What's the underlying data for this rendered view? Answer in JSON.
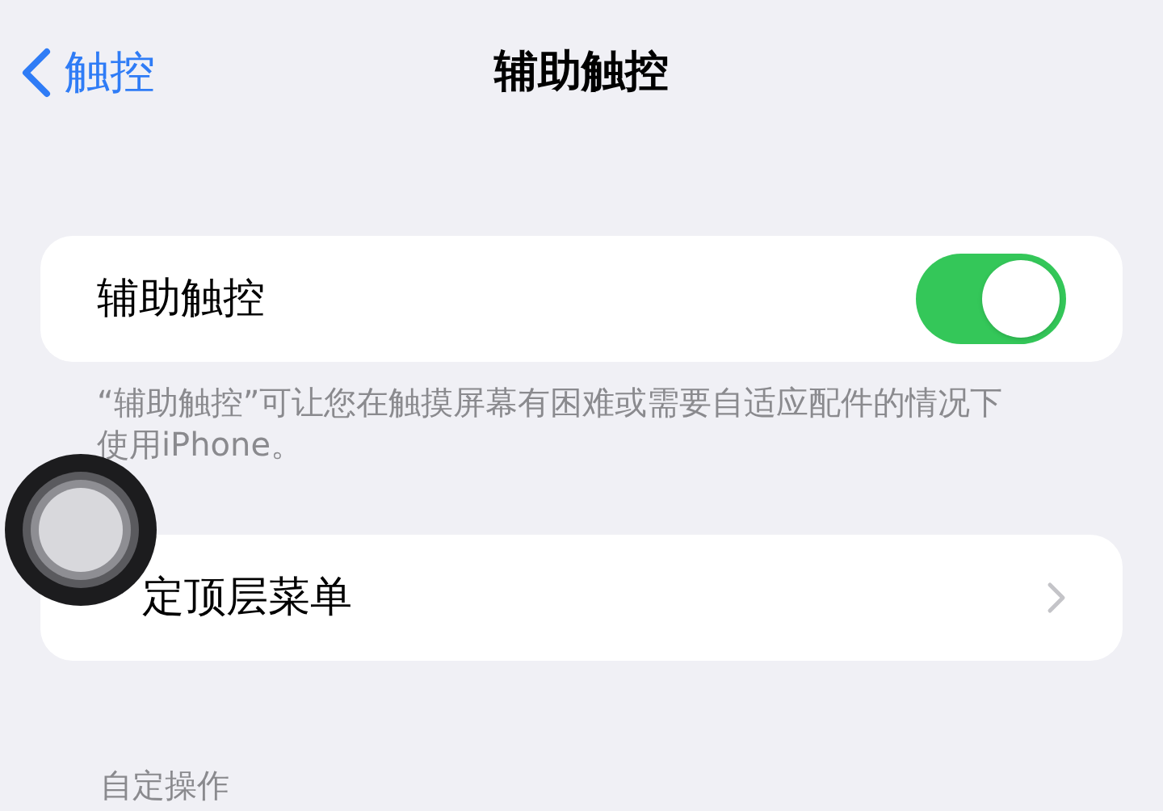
{
  "nav": {
    "back_label": "触控",
    "title": "辅助触控"
  },
  "toggle_row": {
    "label": "辅助触控",
    "on": true
  },
  "footer": "“辅助触控”可让您在触摸屏幕有困难或需要自适应配件的情况下使用iPhone。",
  "menu_row": {
    "label": "定顶层菜单"
  },
  "section_header": "自定操作"
}
